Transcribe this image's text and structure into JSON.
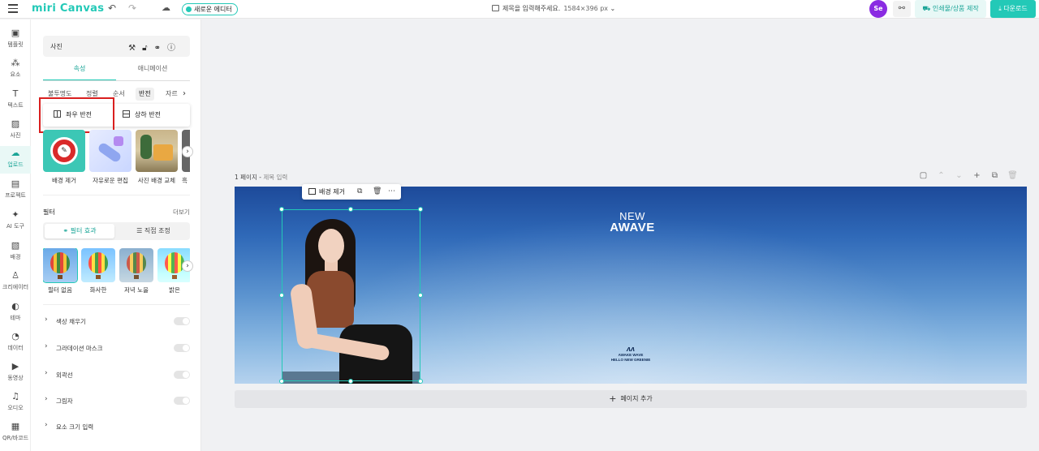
{
  "topbar": {
    "logo": "miri Canvas",
    "new_editor": "새로운 에디터",
    "doc_title": "제목을 입력해주세요.",
    "doc_size": "1584×396 px",
    "avatar": "Se",
    "print_label": "인쇄물/상품 제작",
    "download_label": "다운로드"
  },
  "rail": {
    "items": [
      {
        "label": "템플릿",
        "icon": "▣"
      },
      {
        "label": "요소",
        "icon": "⁂"
      },
      {
        "label": "텍스트",
        "icon": "T"
      },
      {
        "label": "사진",
        "icon": "▨"
      },
      {
        "label": "업로드",
        "icon": "☁"
      },
      {
        "label": "프로젝트",
        "icon": "▤"
      },
      {
        "label": "AI 도구",
        "icon": "✦"
      },
      {
        "label": "배경",
        "icon": "▧"
      },
      {
        "label": "크리에이터",
        "icon": "♙"
      },
      {
        "label": "테마",
        "icon": "◐"
      },
      {
        "label": "데이터",
        "icon": "◔"
      },
      {
        "label": "동영상",
        "icon": "▶"
      },
      {
        "label": "오디오",
        "icon": "♫"
      },
      {
        "label": "QR/바코드",
        "icon": "▦"
      }
    ],
    "active_index": 4
  },
  "panel": {
    "header_title": "사진",
    "tabs": [
      "속성",
      "애니메이션"
    ],
    "subtabs": [
      "불투명도",
      "정렬",
      "순서",
      "반전",
      "자르기"
    ],
    "active_subtab": "반전",
    "flip_options": [
      "좌우 반전",
      "상하 반전"
    ],
    "cards": [
      "배경 제거",
      "자유로운 편집",
      "사진 배경 교체",
      "흑"
    ],
    "filter_title": "필터",
    "filter_more": "더보기",
    "filter_modes": [
      "필터 효과",
      "직접 조정"
    ],
    "filters": [
      "필터 없음",
      "화사한",
      "저녁 노을",
      "밝은"
    ],
    "options": [
      "색상 채우기",
      "그라데이션 마스크",
      "외곽선",
      "그림자",
      "요소 크기 입력"
    ]
  },
  "canvas": {
    "page_label": "1 페이지",
    "page_title_placeholder": "제목 입력",
    "headline_1": "NEW",
    "headline_2": "AWAVE",
    "brand_line_1": "AWAKE WAVE",
    "brand_line_2": "HELLO NEW GREENIE",
    "context_bg_remove": "배경 제거",
    "add_page": "페이지 추가"
  },
  "colors": {
    "accent": "#23c9b7",
    "highlight_box": "#d91f1f",
    "avatar_bg": "#8a2be2"
  }
}
